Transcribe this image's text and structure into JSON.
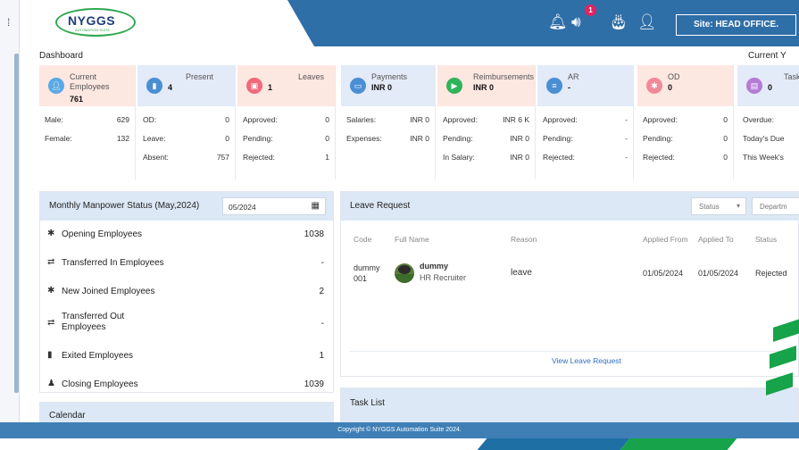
{
  "app": {
    "logo_name": "NYGGS",
    "logo_tagline": "AUTOMATION SUITE",
    "notification_count": "1",
    "site_label": "Site: HEAD OFFICE."
  },
  "dashboard": {
    "title": "Dashboard",
    "current_year_label": "Current Y"
  },
  "cards": [
    {
      "label": "Current Employees",
      "value": "761",
      "color": "#5aa9e6",
      "rows": [
        [
          "Male:",
          "629"
        ],
        [
          "Female:",
          "132"
        ]
      ]
    },
    {
      "label": "Present",
      "value": "4",
      "color": "#4a8fd4",
      "rows": [
        [
          "OD:",
          "0"
        ],
        [
          "Leave:",
          "0"
        ],
        [
          "Absent:",
          "757"
        ]
      ]
    },
    {
      "label": "Leaves",
      "value": "1",
      "color": "#f06a7a",
      "rows": [
        [
          "Approved:",
          "0"
        ],
        [
          "Pending:",
          "0"
        ],
        [
          "Rejected:",
          "1"
        ]
      ]
    },
    {
      "label": "Payments",
      "value": "INR 0",
      "color": "#4a8fd4",
      "rows": [
        [
          "Salaries:",
          "INR 0"
        ],
        [
          "Expenses:",
          "INR 0"
        ]
      ]
    },
    {
      "label": "Reimbursements",
      "value": "INR 0",
      "color": "#2fb35a",
      "rows": [
        [
          "Approved:",
          "INR 6 K"
        ],
        [
          "Pending:",
          "INR 0"
        ],
        [
          "In Salary:",
          "INR 0"
        ]
      ]
    },
    {
      "label": "AR",
      "value": "-",
      "color": "#4a8fd4",
      "rows": [
        [
          "Approved:",
          "-"
        ],
        [
          "Pending:",
          "-"
        ],
        [
          "Rejected:",
          "-"
        ]
      ]
    },
    {
      "label": "OD",
      "value": "0",
      "color": "#f08a9a",
      "rows": [
        [
          "Approved:",
          "0"
        ],
        [
          "Pending:",
          "0"
        ],
        [
          "Rejected:",
          "0"
        ]
      ]
    },
    {
      "label": "Task",
      "value": "0",
      "color": "#b57ad6",
      "rows": [
        [
          "Overdue:",
          ""
        ],
        [
          "Today's Due",
          ""
        ],
        [
          "This Week's",
          ""
        ]
      ]
    }
  ],
  "manpower": {
    "title": "Monthly Manpower Status (May,2024)",
    "date_value": "05/2024",
    "rows": [
      {
        "label": "Opening Employees",
        "value": "1038"
      },
      {
        "label": "Transferred In Employees",
        "value": "-"
      },
      {
        "label": "New Joined Employees",
        "value": "2"
      },
      {
        "label": "Transferred Out Employees",
        "value": "-"
      },
      {
        "label": "Exited Employees",
        "value": "1"
      },
      {
        "label": "Closing Employees",
        "value": "1039"
      }
    ]
  },
  "calendar": {
    "title": "Calendar"
  },
  "leave_request": {
    "title": "Leave Request",
    "status_filter": "Status",
    "department_filter": "Departm",
    "columns": [
      "Code",
      "Full Name",
      "Reason",
      "Applied From",
      "Applied To",
      "Status"
    ],
    "row": {
      "code_line1": "dummy",
      "code_line2": "001",
      "name": "dummy",
      "designation": "HR Recruiter",
      "reason": "leave",
      "applied_from": "01/05/2024",
      "applied_to": "01/05/2024",
      "status": "Rejected"
    },
    "view_link": "View Leave Request"
  },
  "task_list": {
    "title": "Task List"
  },
  "footer": {
    "copyright": "Copyright © NYGGS Automation Suite 2024."
  }
}
